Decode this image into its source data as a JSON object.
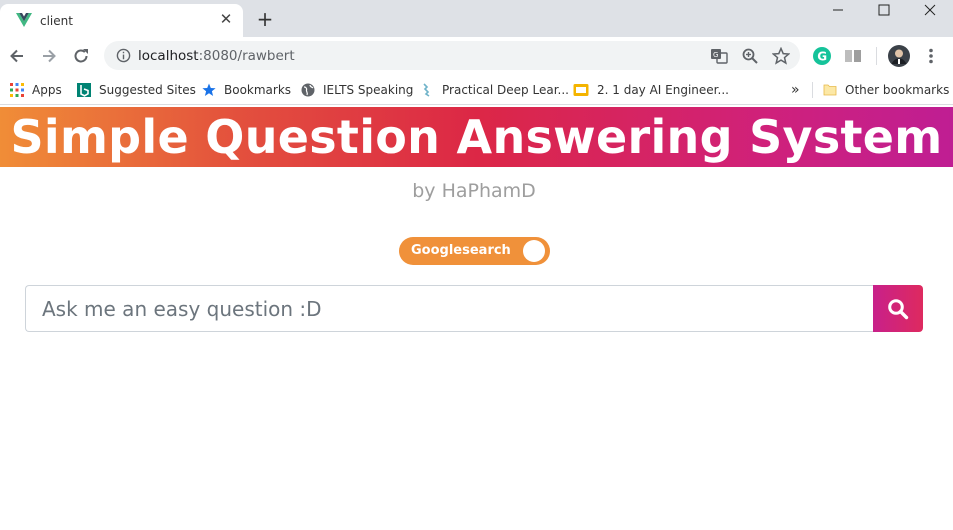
{
  "browser": {
    "tab": {
      "title": "client",
      "favicon": "vue-logo-icon"
    },
    "address": {
      "host": "localhost",
      "port_path": ":8080/rawbert"
    },
    "window_controls": [
      "minimize-icon",
      "maximize-icon",
      "close-icon"
    ]
  },
  "bookmarks": [
    {
      "label": "Apps",
      "icon": "apps-grid-icon"
    },
    {
      "label": "Suggested Sites",
      "icon": "bing-icon"
    },
    {
      "label": "Bookmarks",
      "icon": "star-icon"
    },
    {
      "label": "IELTS Speaking",
      "icon": "globe-icon"
    },
    {
      "label": "Practical Deep Lear...",
      "icon": "site-icon"
    },
    {
      "label": "2. 1 day AI Engineer...",
      "icon": "slides-icon"
    }
  ],
  "other_bookmarks": "Other bookmarks",
  "page": {
    "title": "Simple Question Answering System",
    "byline": "by HaPhamD",
    "toggle": {
      "label": "Googlesearch",
      "on": true
    },
    "search": {
      "placeholder": "Ask me an easy question :D",
      "value": ""
    }
  },
  "colors": {
    "banner_gradient": [
      "#f08d37",
      "#dc2746",
      "#bf1e93"
    ],
    "toggle": "#f0913a",
    "search_button": [
      "#c8208a",
      "#de2a5f"
    ]
  }
}
